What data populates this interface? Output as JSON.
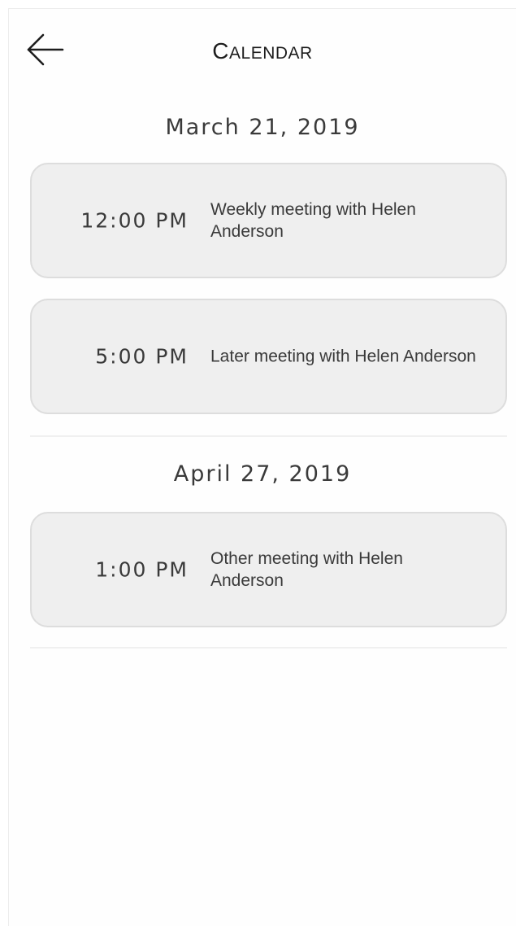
{
  "header": {
    "title_first": "C",
    "title_rest": "ALENDAR",
    "back_icon": "arrow-left-icon"
  },
  "days": [
    {
      "date": "March 21, 2019",
      "events": [
        {
          "time": "12:00 PM",
          "title": "Weekly meeting with Helen Anderson"
        },
        {
          "time": "5:00 PM",
          "title": "Later meeting with Helen Anderson"
        }
      ]
    },
    {
      "date": "April 27, 2019",
      "events": [
        {
          "time": "1:00 PM",
          "title": "Other meeting with Helen Anderson"
        }
      ]
    }
  ],
  "colors": {
    "card_background": "#efefef",
    "card_border": "#dddddd",
    "text": "#3a3a3a"
  }
}
